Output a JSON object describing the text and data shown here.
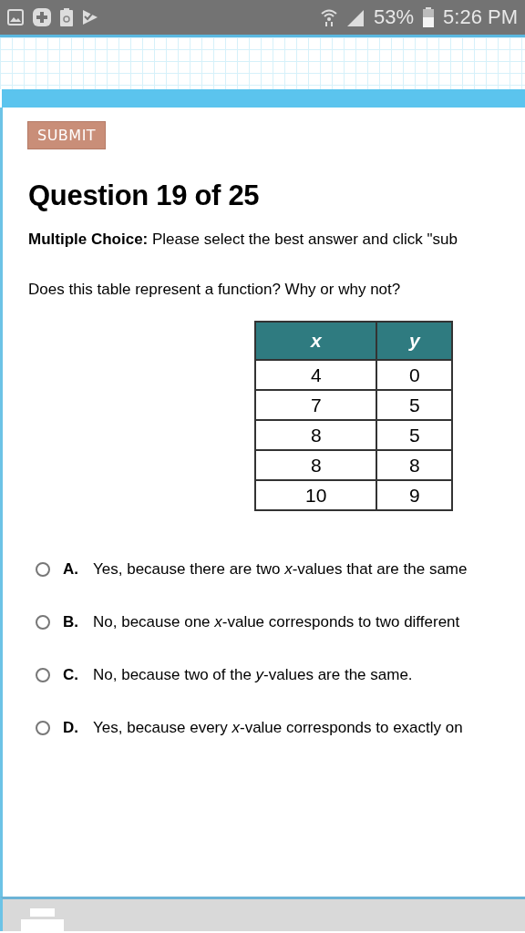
{
  "status_bar": {
    "battery": "53%",
    "time": "5:26 PM"
  },
  "submit_button": {
    "label": "SUBMIT"
  },
  "question": {
    "title": "Question 19 of 25",
    "instruction": "**Multiple Choice:** Please select the best answer and click \"sub",
    "prompt": "Does this table represent a function? Why or why not?"
  },
  "table": {
    "columns": [
      "x",
      "y"
    ],
    "rows": [
      [
        "4",
        "0"
      ],
      [
        "7",
        "5"
      ],
      [
        "8",
        "5"
      ],
      [
        "8",
        "8"
      ],
      [
        "10",
        "9"
      ]
    ]
  },
  "choices": [
    {
      "letter": "A.",
      "text": "Yes, because there are two *x*-values that are the same",
      "selected": false
    },
    {
      "letter": "B.",
      "text": "No, because one *x*-value corresponds to two different",
      "selected": false
    },
    {
      "letter": "C.",
      "text": "No, because two of the *y*-values are the same.",
      "selected": false
    },
    {
      "letter": "D.",
      "text": "Yes, because every *x*-value corresponds to exactly on",
      "selected": false
    }
  ]
}
